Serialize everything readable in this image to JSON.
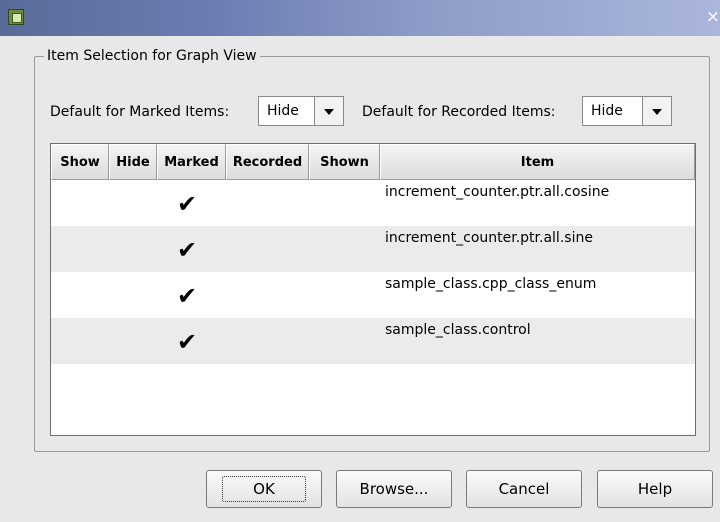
{
  "window": {
    "title": "",
    "close_glyph": "×",
    "icon": "app-icon"
  },
  "group": {
    "legend": "Item Selection for Graph View"
  },
  "defaults": {
    "marked_label": "Default for Marked Items:",
    "marked_value": "Hide",
    "recorded_label": "Default for Recorded Items:",
    "recorded_value": "Hide"
  },
  "table": {
    "columns": [
      "Show",
      "Hide",
      "Marked",
      "Recorded",
      "Shown",
      "Item"
    ],
    "rows": [
      {
        "show": "",
        "hide": "",
        "marked": "✔",
        "recorded": "",
        "shown": "",
        "item": "increment_counter.ptr.all.cosine"
      },
      {
        "show": "",
        "hide": "",
        "marked": "✔",
        "recorded": "",
        "shown": "",
        "item": "increment_counter.ptr.all.sine"
      },
      {
        "show": "",
        "hide": "",
        "marked": "✔",
        "recorded": "",
        "shown": "",
        "item": "sample_class.cpp_class_enum"
      },
      {
        "show": "",
        "hide": "",
        "marked": "✔",
        "recorded": "",
        "shown": "",
        "item": "sample_class.control"
      }
    ]
  },
  "buttons": {
    "ok": "OK",
    "browse": "Browse...",
    "cancel": "Cancel",
    "help": "Help"
  }
}
